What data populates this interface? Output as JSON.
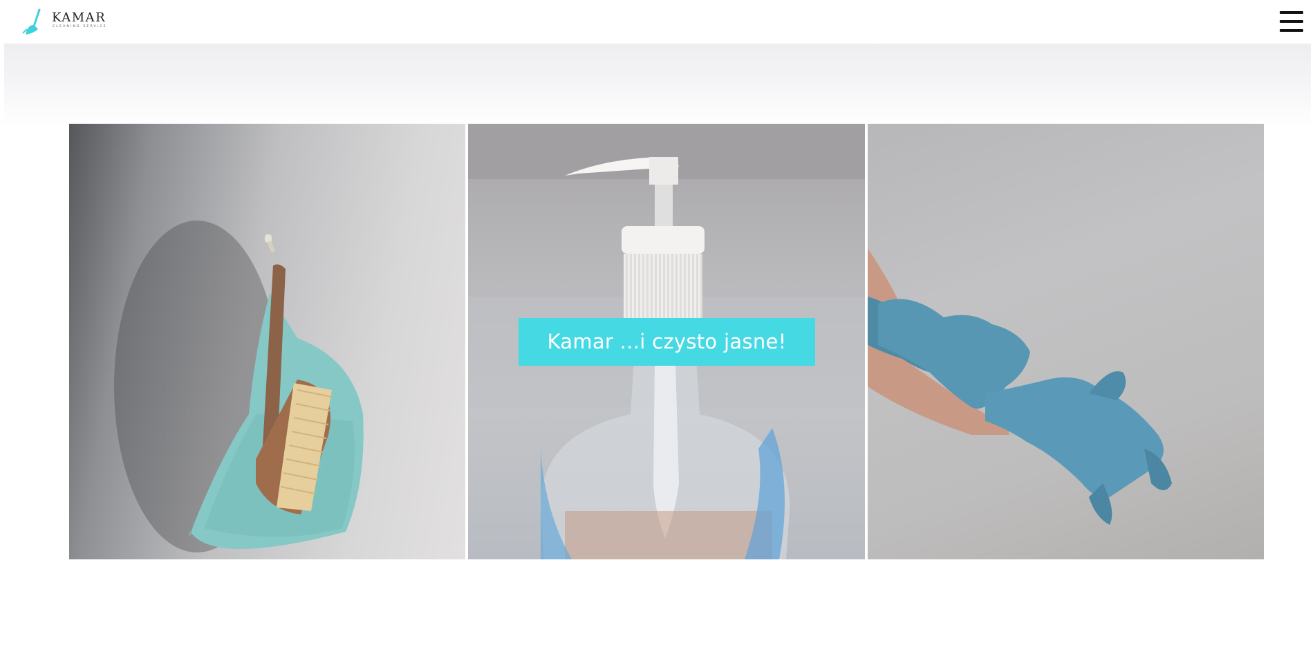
{
  "header": {
    "logo": {
      "brand": "KAMAR",
      "subtitle": "CLEANING SERVICE",
      "icon": "broom-logo-icon",
      "accent_color": "#3fd0d9"
    },
    "menu_icon": "hamburger-menu-icon"
  },
  "hero": {
    "tagline": "Kamar ...i czysto jasne!",
    "tagline_bg": "#44d9e3",
    "images": [
      {
        "icon": "dustpan-and-brush-image"
      },
      {
        "icon": "soap-dispenser-image"
      },
      {
        "icon": "blue-gloves-image"
      }
    ]
  }
}
